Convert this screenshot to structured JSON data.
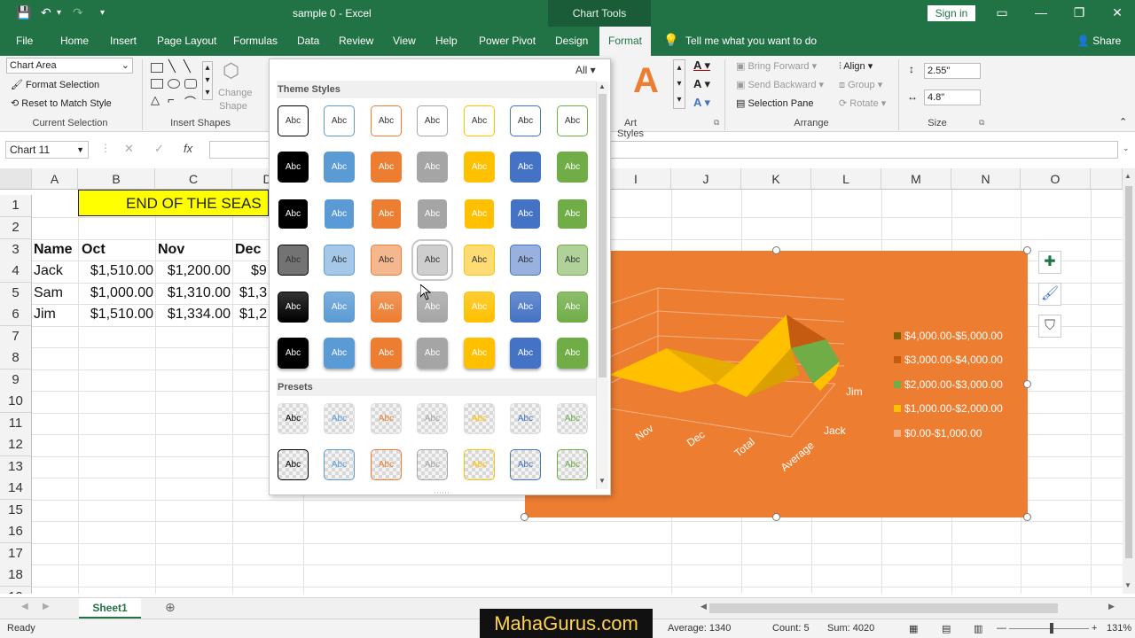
{
  "window": {
    "doc_title": "sample 0  -  Excel",
    "context_tab": "Chart Tools",
    "sign_in": "Sign in"
  },
  "tabs": [
    "File",
    "Home",
    "Insert",
    "Page Layout",
    "Formulas",
    "Data",
    "Review",
    "View",
    "Help",
    "Power Pivot",
    "Design"
  ],
  "active_tab": "Format",
  "tell_me": "Tell me what you want to do",
  "share": "Share",
  "ribbon": {
    "current_selection": {
      "dropdown": "Chart Area",
      "format_selection": "Format Selection",
      "reset": "Reset to Match Style",
      "label": "Current Selection"
    },
    "insert_shapes": {
      "change_shape": "Change",
      "change_shape2": "Shape",
      "label": "Insert Shapes"
    },
    "art_styles_label": "Art Styles",
    "arrange": {
      "bring_forward": "Bring Forward",
      "send_backward": "Send Backward",
      "selection_pane": "Selection Pane",
      "align": "Align",
      "group": "Group",
      "rotate": "Rotate",
      "label": "Arrange"
    },
    "size": {
      "height": "2.55\"",
      "width": "4.8\"",
      "label": "Size"
    }
  },
  "formula_bar": {
    "name_box": "Chart 11",
    "fx": "fx"
  },
  "grid": {
    "columns": [
      "A",
      "B",
      "C",
      "D",
      "I",
      "J",
      "K",
      "L",
      "M",
      "N",
      "O"
    ],
    "rows": [
      "1",
      "2",
      "3",
      "4",
      "5",
      "6",
      "7",
      "8",
      "9",
      "10",
      "11",
      "12",
      "13",
      "14",
      "15",
      "16",
      "17",
      "18",
      "19"
    ],
    "title_cell": "END OF THE SEAS",
    "header": [
      "Name",
      "Oct",
      "Nov",
      "Dec"
    ],
    "data": [
      [
        "Jack",
        "$1,510.00",
        "$1,200.00",
        "$9"
      ],
      [
        "Sam",
        "$1,000.00",
        "$1,310.00",
        "$1,3"
      ],
      [
        "Jim",
        "$1,510.00",
        "$1,334.00",
        "$1,2"
      ]
    ]
  },
  "gallery": {
    "filter": "All",
    "theme_styles": "Theme Styles",
    "presets": "Presets",
    "swatch_text": "Abc",
    "colors": [
      "#000000",
      "#5b9bd5",
      "#ed7d31",
      "#a5a5a5",
      "#ffc000",
      "#4472c4",
      "#70ad47"
    ]
  },
  "chart": {
    "legend": [
      {
        "label": "$4,000.00-$5,000.00",
        "color": "#7f6000"
      },
      {
        "label": "$3,000.00-$4,000.00",
        "color": "#c55a11"
      },
      {
        "label": "$2,000.00-$3,000.00",
        "color": "#70ad47"
      },
      {
        "label": "$1,000.00-$2,000.00",
        "color": "#ffc000"
      },
      {
        "label": "$0.00-$1,000.00",
        "color": "#f4b183"
      }
    ],
    "x_labels": [
      "Nov",
      "Dec",
      "Total",
      "Average"
    ],
    "depth_labels": [
      "Jim",
      "Jack"
    ]
  },
  "sheet_tab": "Sheet1",
  "status": {
    "ready": "Ready",
    "average": "Average: 1340",
    "count": "Count: 5",
    "sum": "Sum: 4020",
    "zoom": "131%"
  },
  "watermark": "MahaGurus.com"
}
